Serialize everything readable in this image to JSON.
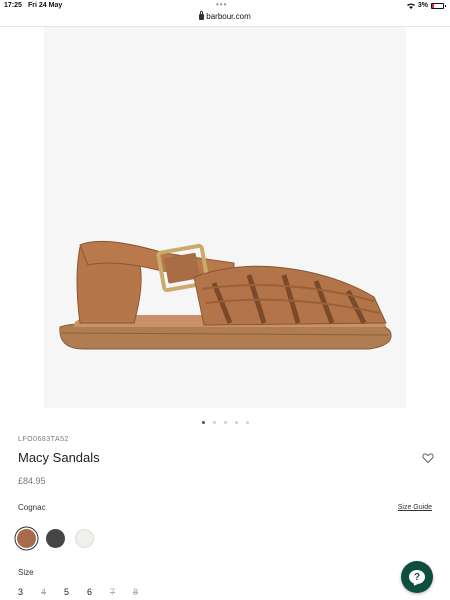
{
  "status_bar": {
    "time": "17:25",
    "date": "Fri 24 May",
    "battery": "3%",
    "battery_color": "#d33333"
  },
  "browser": {
    "url": "barbour.com"
  },
  "product": {
    "sku": "LFO0683TA52",
    "title": "Macy Sandals",
    "price": "£84.95",
    "image_alt": "Tan leather fisherman sandal",
    "image_slide_count": 5,
    "image_slide_active": 1
  },
  "colour": {
    "selected_name": "Cognac",
    "size_guide_label": "Size Guide",
    "swatches": [
      {
        "name": "cognac",
        "color": "#a86a4a",
        "selected": true
      },
      {
        "name": "charcoal",
        "color": "#454545",
        "selected": false
      },
      {
        "name": "off-white",
        "color": "#f1f0ec",
        "selected": false
      }
    ]
  },
  "size": {
    "label": "Size",
    "options": [
      {
        "label": "3",
        "available": true
      },
      {
        "label": "4",
        "available": false
      },
      {
        "label": "5",
        "available": true
      },
      {
        "label": "6",
        "available": true
      },
      {
        "label": "7",
        "available": false
      },
      {
        "label": "8",
        "available": false
      }
    ]
  },
  "help": {
    "icon": "chat-help-icon",
    "glyph": "?",
    "color": "#0d4f3c"
  },
  "colors": {
    "accent": "#0d4f3c",
    "image_bg": "#f6f6f6"
  }
}
